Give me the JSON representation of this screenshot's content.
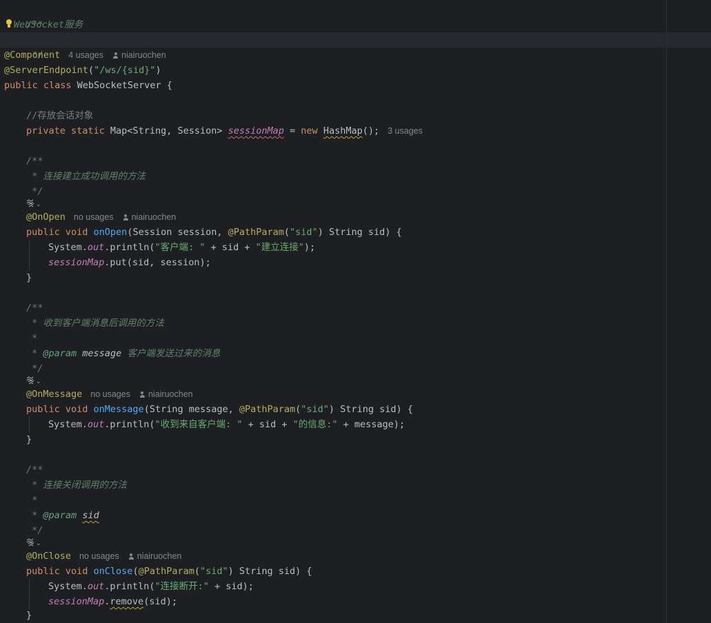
{
  "editor": {
    "colors": {
      "background": "#1e1f22",
      "keyword": "#cf8e6d",
      "annotation": "#b3ae60",
      "string": "#6aab73",
      "field": "#c77dbb",
      "doc_comment": "#5f826b",
      "line_comment": "#7a7e85",
      "inlay_hint": "#85878c"
    },
    "icons": {
      "intention": "lightbulb-icon",
      "author": "user-icon",
      "implements": "websocket-endpoint-icon"
    },
    "lines": {
      "l1": "/**",
      "l2": "WebSocket服务",
      "l3": " */",
      "l4_ann": "@Component",
      "l4_usages": "4 usages",
      "l4_author": "niairuochen",
      "l5_ann": "@ServerEndpoint",
      "l5_open": "(",
      "l5_str": "\"/ws/{sid}\"",
      "l5_close": ")",
      "l6_kw": "public class",
      "l6_name": " WebSocketServer {",
      "l8_comment": "//存放会话对象",
      "l9_kw": "private static",
      "l9_type": " Map<String, Session> ",
      "l9_field": "sessionMap",
      "l9_eq": " = ",
      "l9_new": "new",
      "l9_space": " ",
      "l9_hashmap": "HashMap",
      "l9_end": "();",
      "l9_usages": "3 usages",
      "l11": "/**",
      "l12": " * 连接建立成功调用的方法",
      "l13": " */",
      "l15_ann": "@OnOpen",
      "l15_usages": "no usages",
      "l15_author": "niairuochen",
      "l16_kw": "public void",
      "l16_fn": " onOpen",
      "l16_a": "(Session session, ",
      "l16_ann": "@PathParam",
      "l16_p": "(",
      "l16_str": "\"sid\"",
      "l16_b": ") String sid) {",
      "l17_a": "System.",
      "l17_out": "out",
      "l17_b": ".println(",
      "l17_s1": "\"客户端: \"",
      "l17_c": " + sid + ",
      "l17_s2": "\"建立连接\"",
      "l17_d": ");",
      "l18_field": "sessionMap",
      "l18_b": ".put(sid, session);",
      "l19": "}",
      "l21": "/**",
      "l22": " * 收到客户端消息后调用的方法",
      "l23": " *",
      "l24_star": " * ",
      "l24_tag": "@param",
      "l24_name": " message",
      "l24_desc": " 客户端发送过来的消息",
      "l25": " */",
      "l27_ann": "@OnMessage",
      "l27_usages": "no usages",
      "l27_author": "niairuochen",
      "l28_kw": "public void",
      "l28_fn": " onMessage",
      "l28_a": "(String message, ",
      "l28_ann": "@PathParam",
      "l28_p": "(",
      "l28_str": "\"sid\"",
      "l28_b": ") String sid) {",
      "l29_a": "System.",
      "l29_out": "out",
      "l29_b": ".println(",
      "l29_s1": "\"收到来自客户端: \"",
      "l29_c": " + sid + ",
      "l29_s2": "\"的信息:\"",
      "l29_d": " + message);",
      "l30": "}",
      "l32": "/**",
      "l33": " * 连接关闭调用的方法",
      "l34": " *",
      "l35_star": " * ",
      "l35_tag": "@param",
      "l35_space": " ",
      "l35_name": "sid",
      "l36": " */",
      "l38_ann": "@OnClose",
      "l38_usages": "no usages",
      "l38_author": "niairuochen",
      "l39_kw": "public void",
      "l39_fn": " onClose",
      "l39_p": "(",
      "l39_ann": "@PathParam",
      "l39_p2": "(",
      "l39_str": "\"sid\"",
      "l39_b": ") String sid) {",
      "l40_a": "System.",
      "l40_out": "out",
      "l40_b": ".println(",
      "l40_s1": "\"连接断开:\"",
      "l40_c": " + sid);",
      "l41_field": "sessionMap",
      "l41_dot": ".",
      "l41_remove": "remove",
      "l41_b": "(sid);",
      "l42": "}"
    }
  }
}
